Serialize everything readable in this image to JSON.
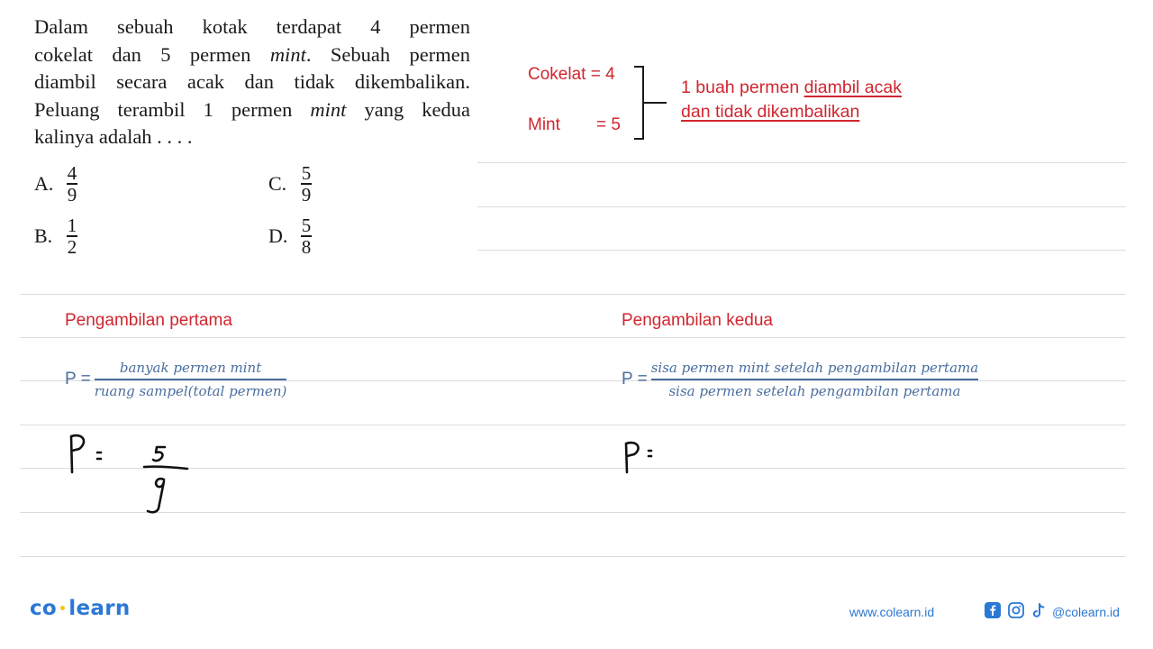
{
  "question": {
    "lines": [
      "Dalam sebuah kotak terdapat 4 permen",
      "cokelat dan 5 permen ",
      "mint",
      ". Sebuah permen",
      "diambil secara acak dan tidak dikembalikan.",
      "Peluang terambil 1 permen ",
      "mint",
      " yang kedua",
      "kalinya adalah . . . ."
    ],
    "options": [
      {
        "letter": "A.",
        "num": "4",
        "den": "9"
      },
      {
        "letter": "B.",
        "num": "1",
        "den": "2"
      },
      {
        "letter": "C.",
        "num": "5",
        "den": "9"
      },
      {
        "letter": "D.",
        "num": "5",
        "den": "8"
      }
    ]
  },
  "given": {
    "cokelat_label": "Cokelat = 4",
    "mint_label": "Mint",
    "mint_value": "= 5",
    "note_plain": "1 buah permen ",
    "note_underline_1": "diambil acak",
    "note_underline_2": "dan tidak dikembalikan"
  },
  "first_draw": {
    "title": "Pengambilan pertama",
    "p_label": "P =",
    "numerator": "banyak permen mint",
    "denominator": "ruang sampel(total permen)",
    "handwritten": {
      "lhs": "P",
      "eq": "=",
      "num": "5",
      "den": "9"
    }
  },
  "second_draw": {
    "title": "Pengambilan kedua",
    "p_label": "P =",
    "numerator": "sisa permen mint setelah pengambilan pertama",
    "denominator": "sisa permen setelah pengambilan pertama",
    "handwritten": {
      "lhs": "P",
      "eq": "="
    }
  },
  "footer": {
    "logo_left": "co",
    "logo_dot": "•",
    "logo_right": "learn",
    "website": "www.colearn.id",
    "social_icons": [
      "facebook-icon",
      "instagram-icon",
      "tiktok-icon"
    ],
    "handle": "@colearn.id"
  },
  "colors": {
    "accent_red": "#d0262f",
    "formula_blue": "#4a6e9e",
    "brand_blue": "#2b78d4",
    "brand_yellow": "#f5c518"
  }
}
